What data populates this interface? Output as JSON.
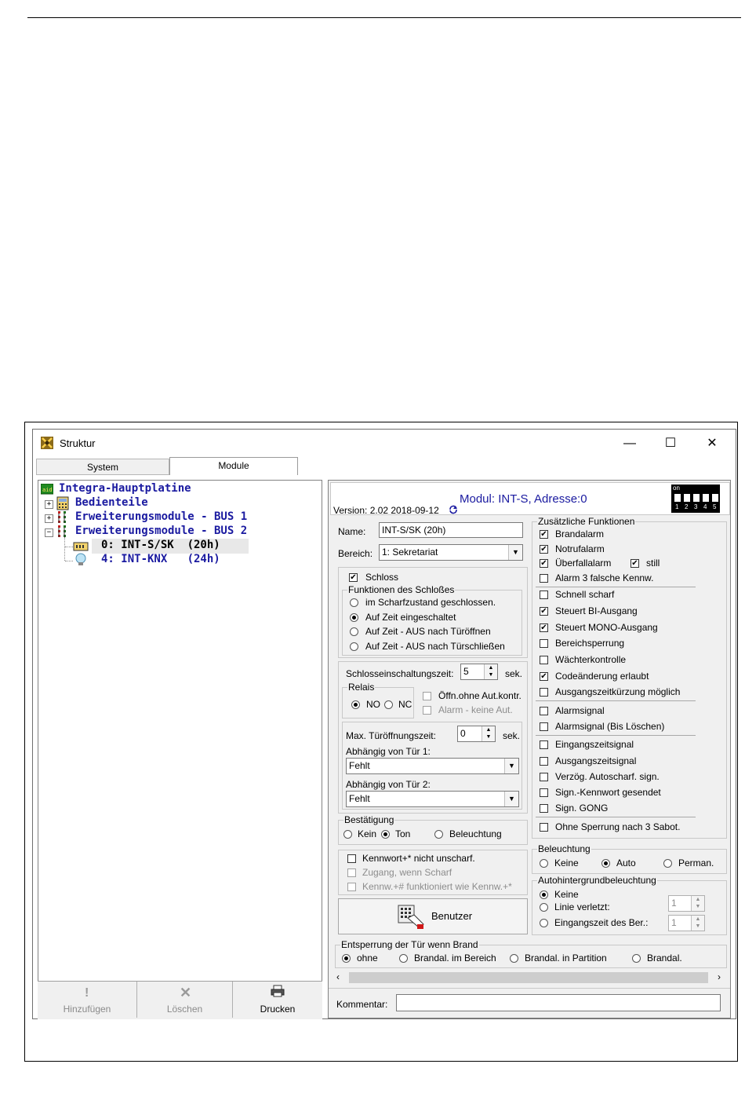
{
  "window": {
    "title": "Struktur",
    "minimize": "—",
    "maximize": "☐",
    "close": "✕"
  },
  "tabs": [
    "System",
    "Module"
  ],
  "tree": {
    "root": "Integra-Hauptplatine",
    "items": [
      "Bedienteile",
      "Erweiterungsmodule - BUS 1",
      "Erweiterungsmodule - BUS 2",
      "0: INT-S/SK  (20h)",
      "4: INT-KNX   (24h)"
    ]
  },
  "tree_buttons": {
    "add": "Hinzufügen",
    "delete": "Löschen",
    "print": "Drucken"
  },
  "module": {
    "version": "Version: 2.02 2018-09-12",
    "title": "Modul: INT-S, Adresse:0",
    "dip_on": "on",
    "dip_numbers": [
      "1",
      "2",
      "3",
      "4",
      "5"
    ]
  },
  "form": {
    "name_label": "Name:",
    "name_value": "INT-S/SK  (20h)",
    "bereich_label": "Bereich:",
    "bereich_value": "1: Sekretariat",
    "schloss_label": "Schloss",
    "schloss_group": "Funktionen des Schloßes",
    "schloss_options": [
      "im Scharfzustand geschlossen.",
      "Auf Zeit eingeschaltet",
      "Auf Zeit - AUS nach Türöffnen",
      "Auf Zeit - AUS nach Türschließen"
    ],
    "einschaltzeit_label": "Schlosseinschaltungszeit:",
    "einschaltzeit_value": "5",
    "sek": "sek.",
    "relais_label": "Relais",
    "relais_no": "NO",
    "relais_nc": "NC",
    "oeffn_label": "Öffn.ohne Aut.kontr.",
    "alarm_keine": "Alarm - keine Aut.",
    "max_oeffnung_label": "Max. Türöffnungszeit:",
    "max_oeffnung_value": "0",
    "abh_tuer1_label": "Abhängig von Tür 1:",
    "abh_tuer1_value": "Fehlt",
    "abh_tuer2_label": "Abhängig von Tür 2:",
    "abh_tuer2_value": "Fehlt",
    "bestaetigung_label": "Bestätigung",
    "bestaetigung_options": [
      "Kein",
      "Ton",
      "Beleuchtung"
    ],
    "kennwort_options": [
      "Kennwort+* nicht unscharf.",
      "Zugang, wenn Scharf",
      "Kennw.+# funktioniert wie Kennw.+*"
    ],
    "benutzer_button": "Benutzer"
  },
  "zusatz": {
    "title": "Zusätzliche Funktionen",
    "items": [
      "Brandalarm",
      "Notrufalarm",
      "Überfallalarm",
      "Alarm 3 falsche Kennw.",
      "Schnell scharf",
      "Steuert BI-Ausgang",
      "Steuert MONO-Ausgang",
      "Bereichsperrung",
      "Wächterkontrolle",
      "Codeänderung erlaubt",
      "Ausgangszeitkürzung möglich",
      "Alarmsignal",
      "Alarmsignal (Bis Löschen)",
      "Eingangszeitsignal",
      "Ausgangszeitsignal",
      "Verzög. Autoscharf. sign.",
      "Sign.-Kennwort gesendet",
      "Sign. GONG",
      "Ohne Sperrung nach 3 Sabot."
    ],
    "still": "still"
  },
  "beleuchtung": {
    "title": "Beleuchtung",
    "options": [
      "Keine",
      "Auto",
      "Perman."
    ]
  },
  "autohintergrund": {
    "title": "Autohintergrundbeleuchtung",
    "options": [
      "Keine",
      "Linie verletzt:",
      "Eingangszeit des Ber.:"
    ],
    "value1": "1",
    "value2": "1"
  },
  "brand": {
    "title": "Entsperrung der Tür wenn Brand",
    "options": [
      "ohne",
      "Brandal. im Bereich",
      "Brandal. in Partition",
      "Brandal."
    ]
  },
  "kommentar_label": "Kommentar:",
  "kommentar_value": "",
  "colors": {
    "tree_text": "#1a1aa0",
    "title_blue": "#1a1aa0"
  }
}
